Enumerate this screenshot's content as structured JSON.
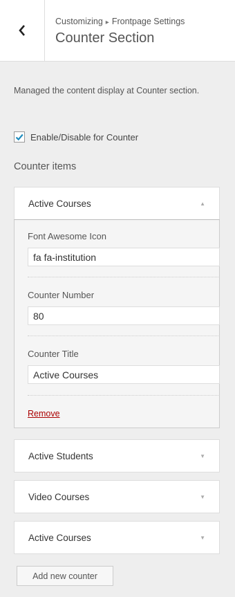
{
  "header": {
    "breadcrumb_prefix": "Customizing",
    "breadcrumb_sep": "▸",
    "breadcrumb_section": "Frontpage Settings",
    "title": "Counter Section"
  },
  "description": "Managed the content display at Counter section.",
  "enable": {
    "label": "Enable/Disable for Counter",
    "checked": true
  },
  "items_heading": "Counter items",
  "items": [
    {
      "title": "Active Courses",
      "expanded": true,
      "fields": {
        "icon_label": "Font Awesome Icon",
        "icon_value": "fa fa-institution",
        "number_label": "Counter Number",
        "number_value": "80",
        "title_label": "Counter Title",
        "title_value": "Active Courses"
      },
      "remove_label": "Remove"
    },
    {
      "title": "Active Students",
      "expanded": false
    },
    {
      "title": "Video Courses",
      "expanded": false
    },
    {
      "title": "Active Courses",
      "expanded": false
    }
  ],
  "add_button_label": "Add new counter",
  "icons": {
    "back": "chevron-left-icon",
    "collapse": "arrow-up-icon",
    "expand": "arrow-down-icon",
    "check": "check-icon"
  },
  "colors": {
    "accent": "#0073aa",
    "remove": "#aa0000"
  }
}
